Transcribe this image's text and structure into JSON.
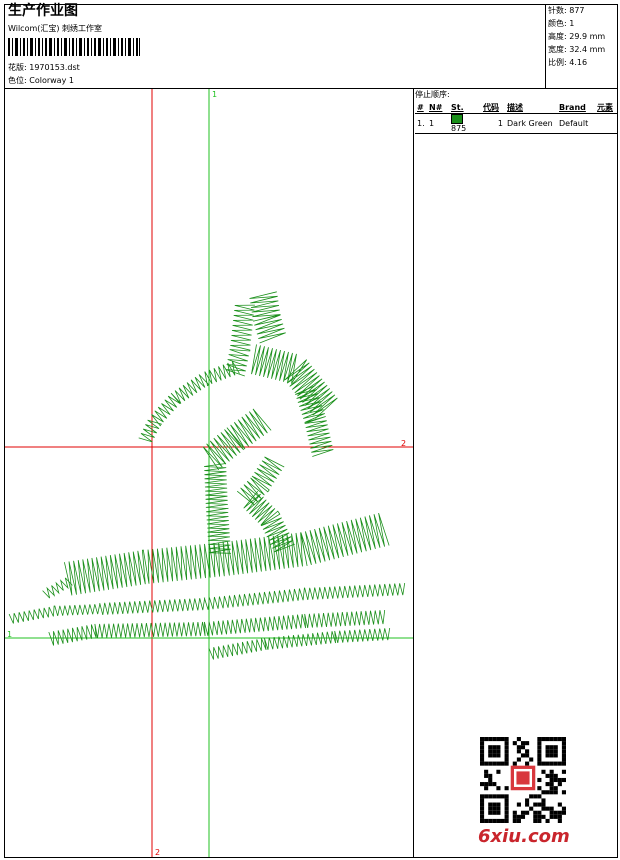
{
  "header": {
    "title": "生产作业图",
    "company": "Wilcom(汇宝) 刺绣工作室",
    "design_label": "花版:",
    "design_value": "1970153.dst",
    "colorway_label": "色位:",
    "colorway_value": "Colorway 1"
  },
  "stats": [
    {
      "label": "针数:",
      "value": "877"
    },
    {
      "label": "颜色:",
      "value": "1"
    },
    {
      "label": "高度:",
      "value": "29.9 mm"
    },
    {
      "label": "宽度:",
      "value": "32.4 mm"
    },
    {
      "label": "比例:",
      "value": "4.16"
    }
  ],
  "stop_sequence": {
    "title": "停止顺序:",
    "columns": [
      "#",
      "N#",
      "St.",
      "代码",
      "描述",
      "Brand",
      "元素"
    ],
    "rows": [
      {
        "index": "1.",
        "n": "1",
        "color": "#1a8f1a",
        "stitches": "875",
        "code": "1",
        "description": "Dark Green",
        "brand": "Default",
        "element": ""
      }
    ]
  },
  "canvas": {
    "axis_markers": {
      "top_green": "1",
      "right_red": "2",
      "left_green": "1",
      "bottom_red": "2"
    },
    "thread_color": "#1a8f1a",
    "guide_red": "#e00000",
    "guide_green": "#22c122"
  },
  "watermark": {
    "site": "6xiu.com"
  }
}
